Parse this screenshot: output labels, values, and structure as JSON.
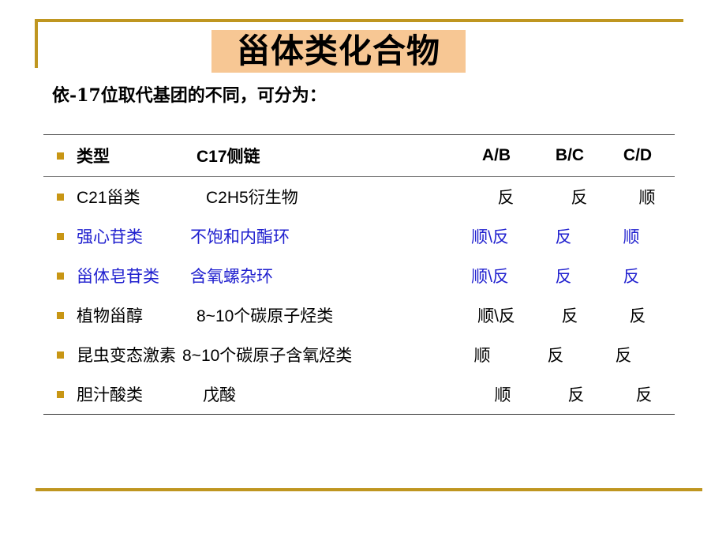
{
  "slide": {
    "title": "甾体类化合物",
    "subtitle": "依-17位取代基团的不同，可分为："
  },
  "colors": {
    "frame_gold": "#bf9620",
    "title_background": "#f7c794",
    "bullet_gold": "#c89614",
    "highlight_blue": "#2020cf",
    "text_black": "#000000"
  },
  "table": {
    "header": {
      "type": "类型",
      "chain": "C17侧链",
      "ab": "A/B",
      "bc": "B/C",
      "cd": "C/D"
    },
    "rows": [
      {
        "bullet": "square-bullet",
        "type": "C21甾类",
        "chain": "C2H5衍生物",
        "ab": "反",
        "bc": "反",
        "cd": "顺",
        "color": "black"
      },
      {
        "bullet": "square-bullet",
        "type": "强心苷类",
        "chain": "不饱和内酯环",
        "ab": "顺\\反",
        "bc": "反",
        "cd": "顺",
        "color": "blue"
      },
      {
        "bullet": "square-bullet",
        "type": "甾体皂苷类",
        "chain": "含氧螺杂环",
        "ab": "顺\\反",
        "bc": "反",
        "cd": "反",
        "color": "blue"
      },
      {
        "bullet": "square-bullet",
        "type": "植物甾醇",
        "chain": "8~10个碳原子烃类",
        "ab": "顺\\反",
        "bc": "反",
        "cd": "反",
        "color": "black"
      },
      {
        "bullet": "square-bullet",
        "type": "昆虫变态激素",
        "chain": "8~10个碳原子含氧烃类",
        "ab": "顺",
        "bc": "反",
        "cd": "反",
        "color": "black"
      },
      {
        "bullet": "square-bullet",
        "type": "胆汁酸类",
        "chain": "戊酸",
        "ab": "顺",
        "bc": "反",
        "cd": "反",
        "color": "black"
      }
    ]
  }
}
